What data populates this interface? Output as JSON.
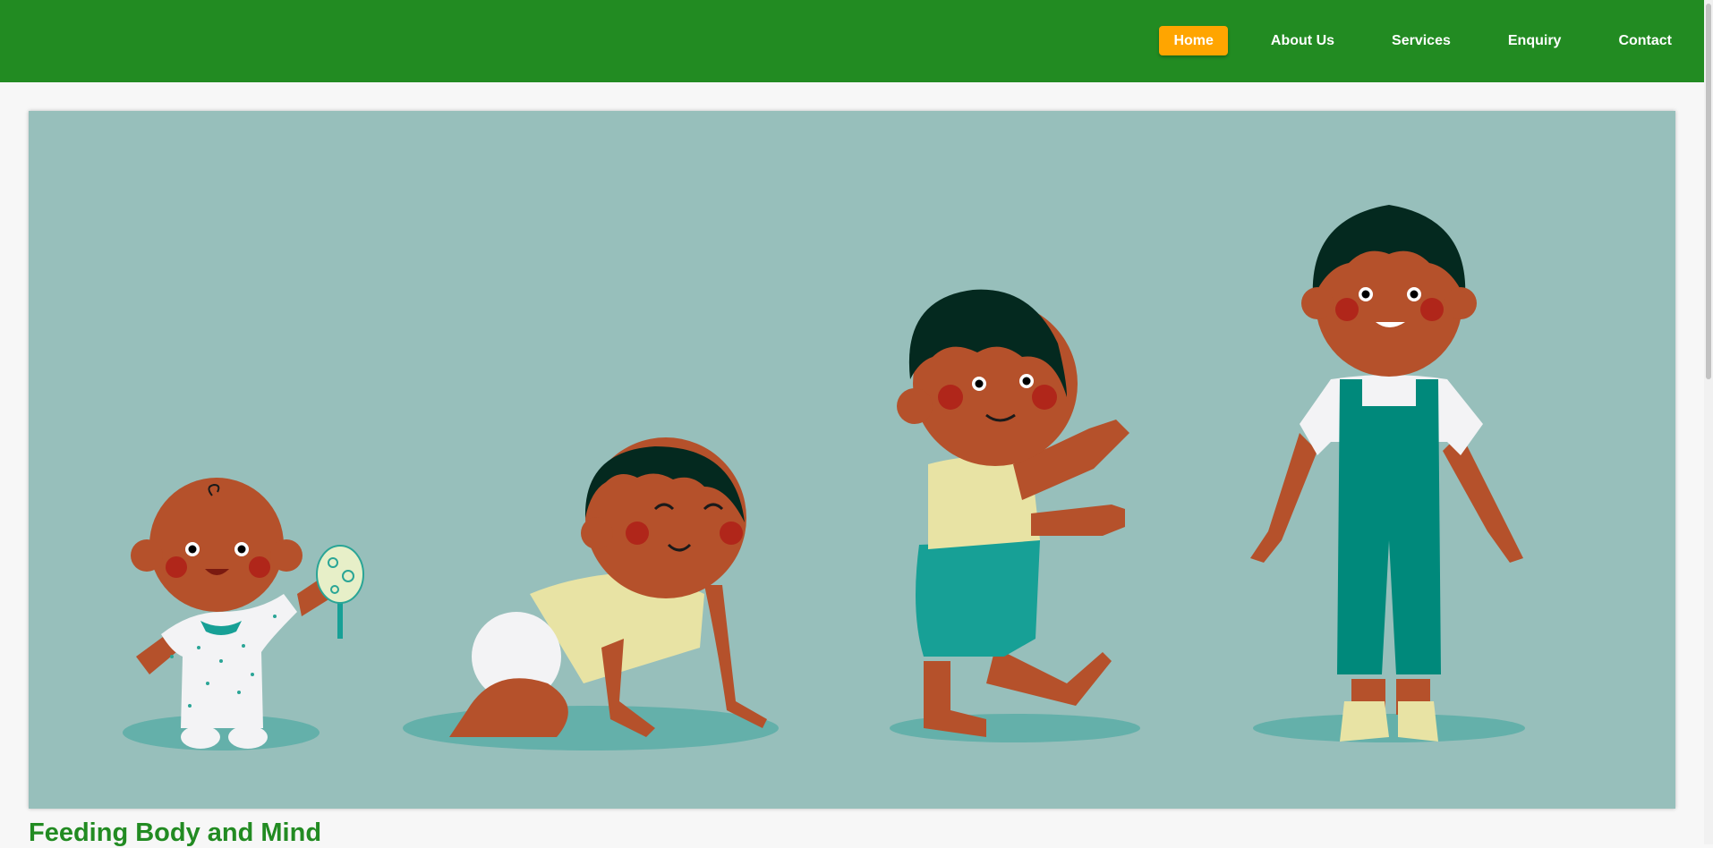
{
  "nav": {
    "items": [
      {
        "label": "Home",
        "active": true
      },
      {
        "label": "About Us",
        "active": false
      },
      {
        "label": "Services",
        "active": false
      },
      {
        "label": "Enquiry",
        "active": false
      },
      {
        "label": "Contact",
        "active": false
      }
    ]
  },
  "hero": {
    "image": "child-growth-stages-illustration",
    "background_color": "#97bfbb",
    "stages": [
      "sitting-baby-with-rattle",
      "crawling-baby",
      "walking-toddler",
      "standing-child-in-overalls"
    ]
  },
  "section": {
    "title": "Feeding Body and Mind"
  },
  "colors": {
    "header": "#228b22",
    "active_nav": "#ffa500",
    "title": "#228b22"
  }
}
